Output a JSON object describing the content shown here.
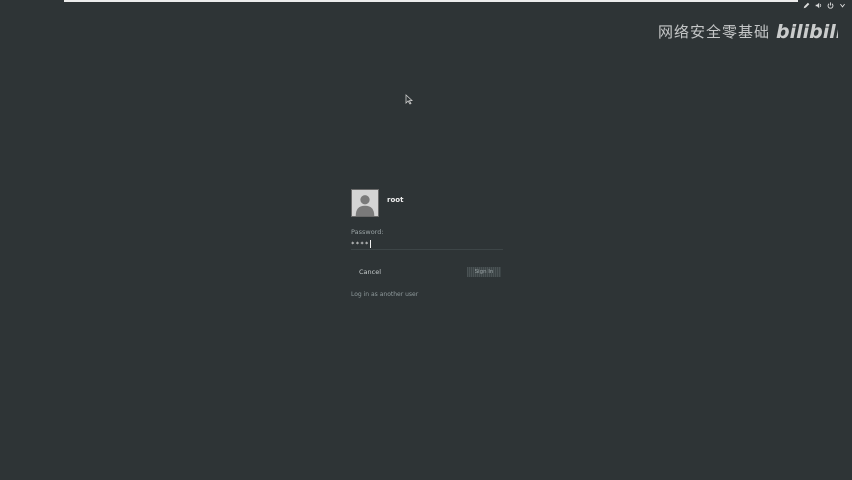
{
  "watermark": {
    "text": "网络安全零基础",
    "logo": "bilibili"
  },
  "status_icons": [
    "pen-icon",
    "volume-icon",
    "power-icon",
    "chevron-down-icon"
  ],
  "login": {
    "username": "root",
    "password_label": "Password:",
    "password_value": "****",
    "cancel_label": "Cancel",
    "signin_label": "Sign In",
    "other_user_link": "Log in as another user"
  },
  "colors": {
    "background": "#2e3436",
    "text": "#f0f0f0",
    "muted_text": "#9aa3a5"
  }
}
